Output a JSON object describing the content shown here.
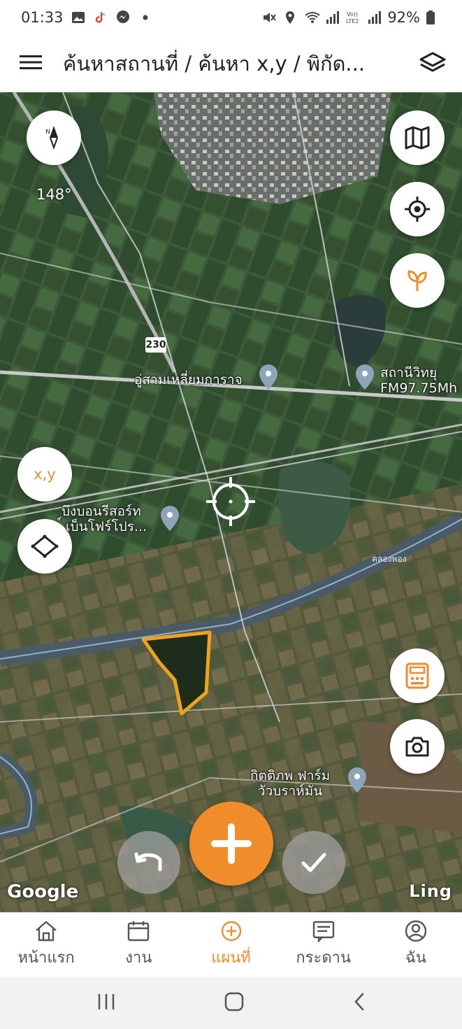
{
  "status_bar": {
    "time": "01:33",
    "battery": "92%",
    "icons": [
      "gallery-icon",
      "tiktok-icon",
      "messenger-icon",
      "dot-icon",
      "mute-icon",
      "location-icon",
      "wifi-icon",
      "signal-icon",
      "lte-icon",
      "battery-icon"
    ]
  },
  "app_bar": {
    "title": "ค้นหาสถานที่ / ค้นหา x,y / พิกัด...",
    "icons": [
      "menu-icon",
      "layers-icon"
    ]
  },
  "map": {
    "compass_bearing": "148°",
    "xy_button_label": "x,y",
    "route_number": "230",
    "road_label": "คลองพอง",
    "pins": [
      {
        "label": "อู่สามเหลี่ยมการาจ"
      },
      {
        "label_line1": "สถานีวิทยุ",
        "label_line2": "FM97.75Mh"
      },
      {
        "label_line1": "บึงบอนรีสอร์ท",
        "label_line2": "์ เบ็นโฟร์โปร..."
      },
      {
        "label_line1": "กิตติภพ ฟาร์ม",
        "label_line2": "วัวบราห์มัน"
      }
    ],
    "google_label": "Google",
    "ling_label": "Ling",
    "accent_color": "#f08c2a"
  },
  "bottom_nav": {
    "items": [
      {
        "label": "หน้าแรก",
        "icon": "home-icon",
        "active": false
      },
      {
        "label": "งาน",
        "icon": "calendar-icon",
        "active": false
      },
      {
        "label": "แผนที่",
        "icon": "add-circle-icon",
        "active": true
      },
      {
        "label": "กระดาน",
        "icon": "board-icon",
        "active": false
      },
      {
        "label": "ฉัน",
        "icon": "profile-icon",
        "active": false
      }
    ]
  }
}
